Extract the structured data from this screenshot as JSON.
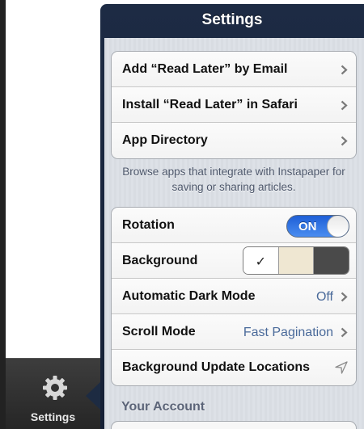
{
  "popover": {
    "title": "Settings"
  },
  "tab_bar": {
    "settings_label": "Settings"
  },
  "group1": {
    "rows": [
      {
        "label": "Add “Read Later” by Email"
      },
      {
        "label": "Install “Read Later” in Safari"
      },
      {
        "label": "App Directory"
      }
    ]
  },
  "note": "Browse apps that integrate with Instapaper for saving or sharing articles.",
  "group2": {
    "rotation": {
      "label": "Rotation",
      "toggle": "ON"
    },
    "background": {
      "label": "Background",
      "selected_mark": "✓",
      "options": [
        "white",
        "sepia",
        "dark"
      ]
    },
    "dark_mode": {
      "label": "Automatic Dark Mode",
      "value": "Off"
    },
    "scroll_mode": {
      "label": "Scroll Mode",
      "value": "Fast Pagination"
    },
    "update_locations": {
      "label": "Background Update Locations"
    }
  },
  "your_account": {
    "header": "Your Account"
  },
  "colors": {
    "popover_navy": "#1d2b44",
    "toggle_blue": "#1e5fd6",
    "value_blue": "#4a6a9a"
  },
  "icons": {
    "tab": "gear-icon",
    "disclosure": "chevron-right-icon",
    "location": "location-arrow-icon"
  }
}
